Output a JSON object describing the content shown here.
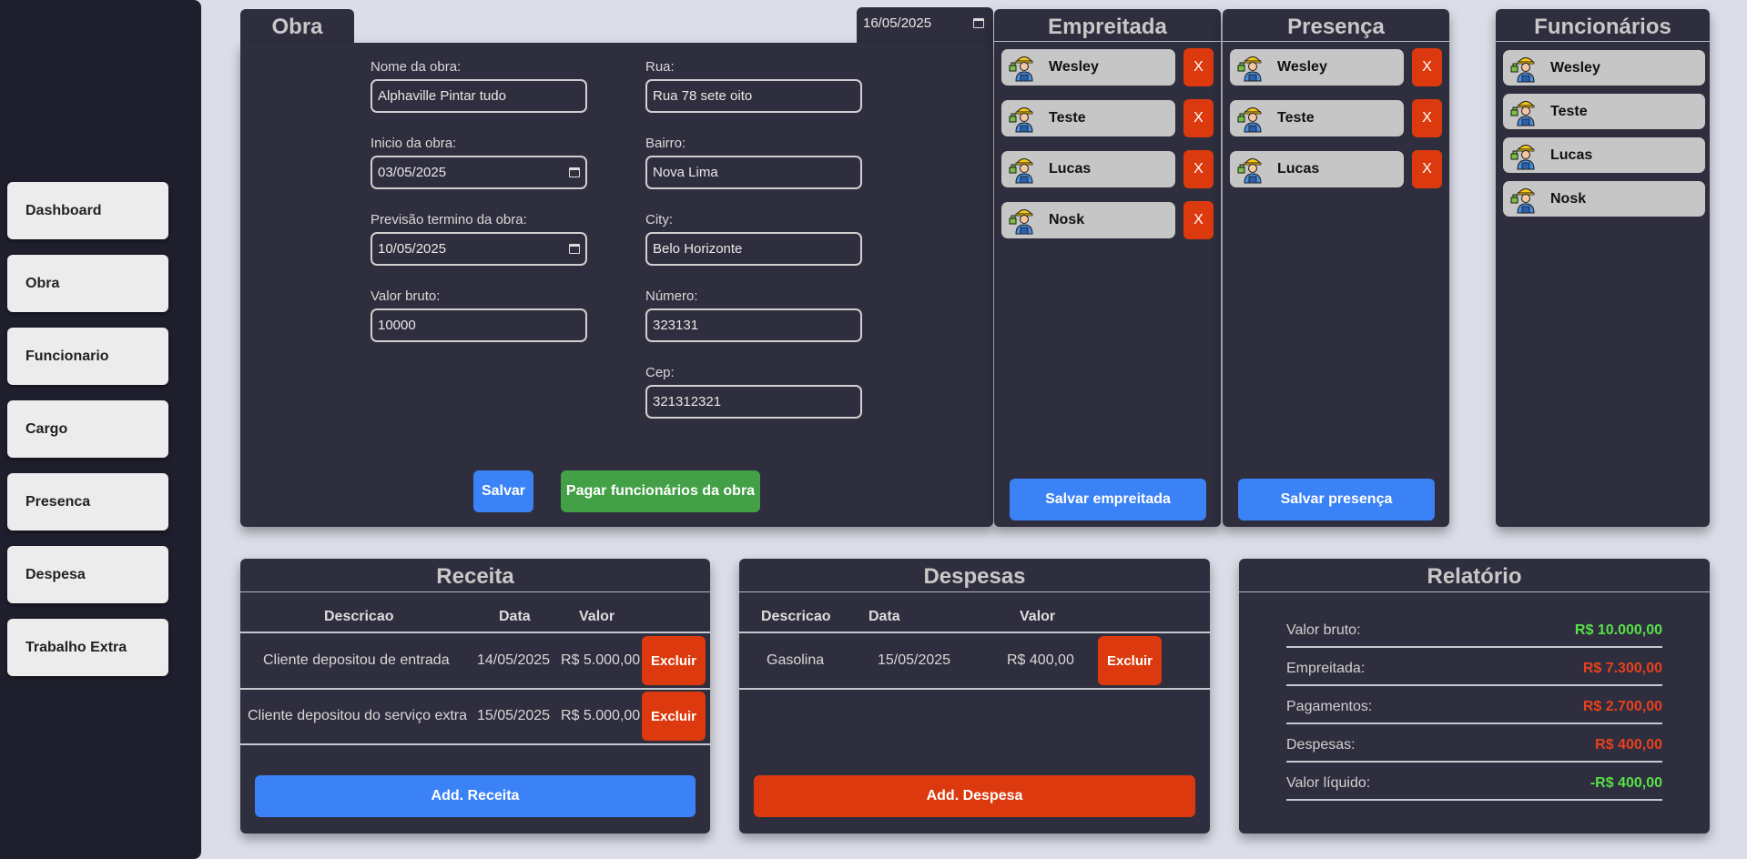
{
  "sidebar": {
    "items": [
      {
        "label": "Dashboard"
      },
      {
        "label": "Obra"
      },
      {
        "label": "Funcionario"
      },
      {
        "label": "Cargo"
      },
      {
        "label": "Presenca"
      },
      {
        "label": "Despesa"
      },
      {
        "label": "Trabalho Extra"
      }
    ]
  },
  "obra": {
    "tab_title": "Obra",
    "date_picker_value": "16/05/2025",
    "fields": {
      "nome_label": "Nome da obra:",
      "nome_value": "Alphaville Pintar tudo",
      "inicio_label": "Inicio da obra:",
      "inicio_value": "03/05/2025",
      "previsao_label": "Previsão termino da obra:",
      "previsao_value": "10/05/2025",
      "valor_label": "Valor bruto:",
      "valor_value": "10000",
      "rua_label": "Rua:",
      "rua_value": "Rua 78 sete oito",
      "bairro_label": "Bairro:",
      "bairro_value": "Nova Lima",
      "city_label": "City:",
      "city_value": "Belo Horizonte",
      "numero_label": "Número:",
      "numero_value": "323131",
      "cep_label": "Cep:",
      "cep_value": "321312321"
    },
    "salvar_label": "Salvar",
    "pagar_label": "Pagar funcionários da obra"
  },
  "empreitada": {
    "title": "Empreitada",
    "items": [
      "Wesley",
      "Teste",
      "Lucas",
      "Nosk"
    ],
    "remove_label": "X",
    "save_label": "Salvar empreitada"
  },
  "presenca": {
    "title": "Presença",
    "items": [
      "Wesley",
      "Teste",
      "Lucas"
    ],
    "remove_label": "X",
    "save_label": "Salvar presença"
  },
  "funcionarios": {
    "title": "Funcionários",
    "items": [
      "Wesley",
      "Teste",
      "Lucas",
      "Nosk"
    ]
  },
  "receita": {
    "title": "Receita",
    "headers": [
      "Descricao",
      "Data",
      "Valor"
    ],
    "rows": [
      {
        "descricao": "Cliente depositou de entrada",
        "data": "14/05/2025",
        "valor": "R$ 5.000,00"
      },
      {
        "descricao": "Cliente depositou do serviço extra",
        "data": "15/05/2025",
        "valor": "R$ 5.000,00"
      }
    ],
    "delete_label": "Excluir",
    "add_label": "Add. Receita"
  },
  "despesas": {
    "title": "Despesas",
    "headers": [
      "Descricao",
      "Data",
      "Valor"
    ],
    "rows": [
      {
        "descricao": "Gasolina",
        "data": "15/05/2025",
        "valor": "R$ 400,00"
      }
    ],
    "delete_label": "Excluir",
    "add_label": "Add. Despesa"
  },
  "relatorio": {
    "title": "Relatório",
    "lines": [
      {
        "label": "Valor bruto:",
        "value": "R$ 10.000,00",
        "color": "#57e04a"
      },
      {
        "label": "Empreitada:",
        "value": "R$ 7.300,00",
        "color": "#e8401c"
      },
      {
        "label": "Pagamentos:",
        "value": "R$ 2.700,00",
        "color": "#e8401c"
      },
      {
        "label": "Despesas:",
        "value": "R$ 400,00",
        "color": "#e8401c"
      },
      {
        "label": "Valor líquido:",
        "value": "-R$ 400,00",
        "color": "#57e04a"
      }
    ]
  },
  "icons": {
    "worker": "worker-avatar-icon",
    "calendar": "calendar-icon"
  }
}
